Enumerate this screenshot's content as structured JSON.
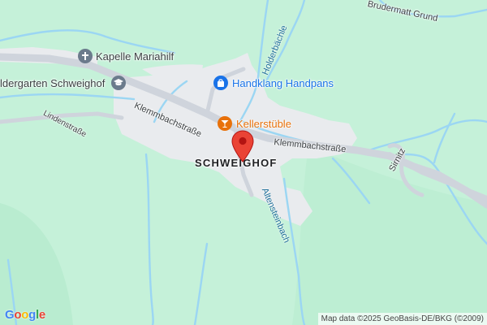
{
  "map": {
    "background_color": "#c5f1d9",
    "water_color": "#9bd6f3",
    "road_color": "#cfd4dc",
    "town_color": "#e9ebee"
  },
  "labels": {
    "kapelle": "Kapelle Mariahilf",
    "kindergarten": "ldergarten Schweighof",
    "handklang": "Handklang Handpans",
    "kellerstuble": "Kellerstüble",
    "town": "SCHWEIGHOF",
    "klemmbach_left": "Klemmbachstraße",
    "klemmbach_right": "Klemmbachstraße",
    "lindenstrasse": "Lindenstraße",
    "sirnitz": "Sirnitz",
    "holderbachle": "Holderbächle",
    "altensteinbach": "Altensteinbach",
    "brudermatt": "Brudermatt Grund"
  },
  "icons": {
    "kapelle": "cross-icon",
    "kindergarten": "school-icon",
    "handklang": "shopping-bag-icon",
    "kellerstuble": "cocktail-icon",
    "marker": "map-pin-icon"
  },
  "footer": {
    "logo": "Google",
    "attribution": "Map data ©2025 GeoBasis-DE/BKG (©2009)"
  }
}
